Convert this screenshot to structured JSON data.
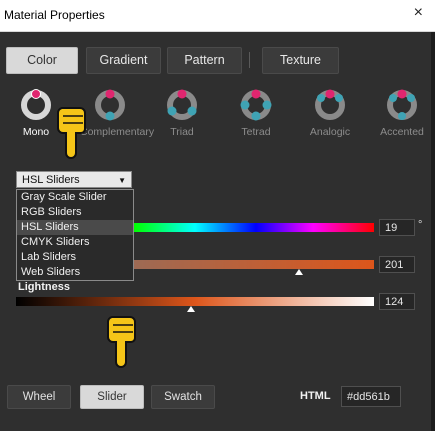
{
  "window": {
    "title": "Material Properties",
    "close_glyph": "×"
  },
  "tabs": [
    "Color",
    "Gradient",
    "Pattern",
    "Texture"
  ],
  "active_tab": "Color",
  "harmonies": [
    {
      "label": "Mono",
      "icon": "mono-harmony-icon"
    },
    {
      "label": "Complementary",
      "icon": "complementary-harmony-icon"
    },
    {
      "label": "Triad",
      "icon": "triad-harmony-icon"
    },
    {
      "label": "Tetrad",
      "icon": "tetrad-harmony-icon"
    },
    {
      "label": "Analogic",
      "icon": "analogic-harmony-icon"
    },
    {
      "label": "Accented",
      "icon": "accented-harmony-icon"
    }
  ],
  "slider_mode": {
    "selected": "HSL Sliders",
    "options": [
      "Gray Scale Slider",
      "RGB Sliders",
      "HSL Sliders",
      "CMYK Sliders",
      "Lab Sliders",
      "Web Sliders"
    ]
  },
  "sliders": {
    "hue": {
      "value": "19",
      "unit": "°",
      "level": 0.053
    },
    "saturation": {
      "value": "201",
      "level": 0.79
    },
    "lightness": {
      "label": "Lightness",
      "value": "124",
      "level": 0.49
    }
  },
  "view_buttons": [
    "Wheel",
    "Slider",
    "Swatch"
  ],
  "active_view": "Slider",
  "html_color": {
    "label": "HTML",
    "value": "#dd561b"
  },
  "colors": {
    "accent": "#dd561b",
    "harmony_pink": "#e0266f",
    "harmony_teal": "#3fa3b4",
    "hand": "#f5c518"
  }
}
